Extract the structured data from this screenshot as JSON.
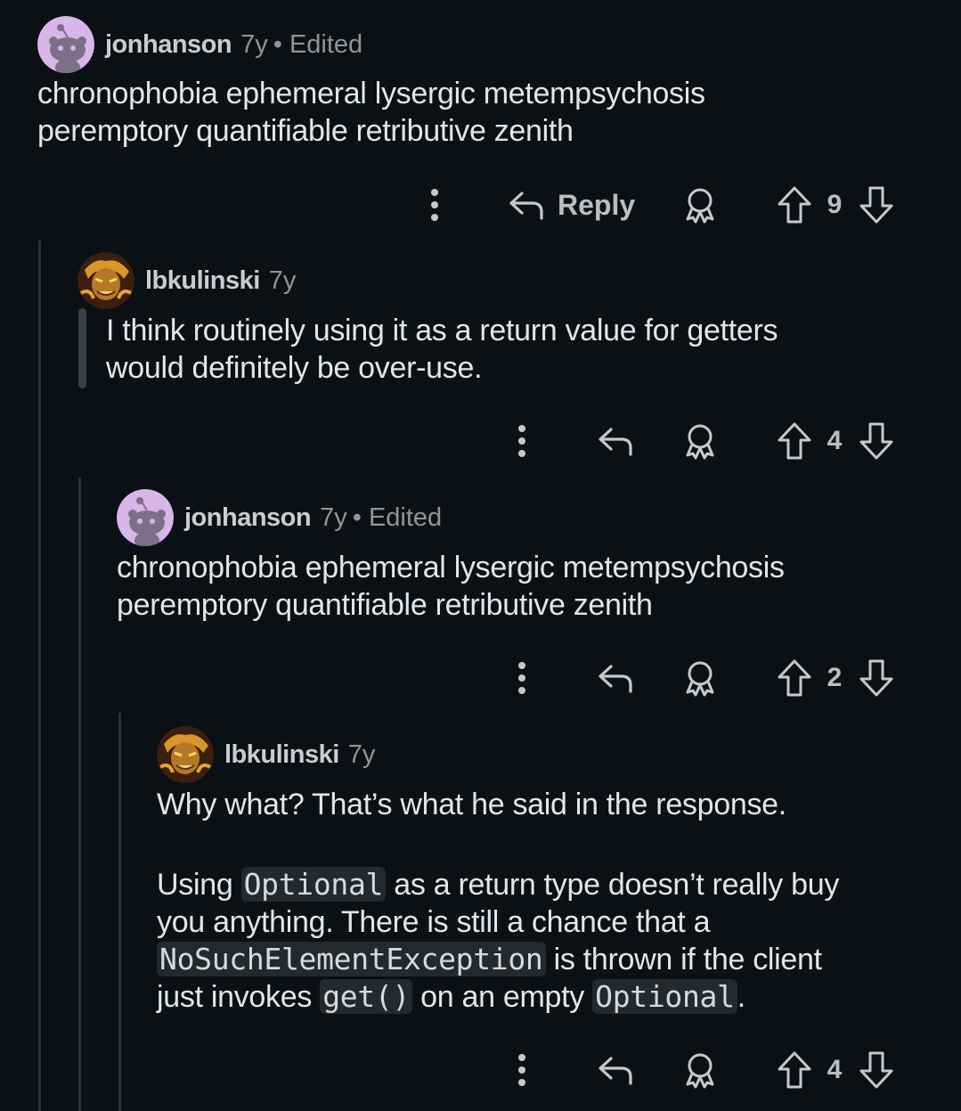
{
  "comments": [
    {
      "username": "jonhanson",
      "age": "7y",
      "edited": "• Edited",
      "text": [
        "chronophobia ephemeral lysergic metempsychosis",
        "peremptory quantifiable retributive zenith"
      ],
      "reply_label": "Reply",
      "votes": "9"
    },
    {
      "username": "lbkulinski",
      "age": "7y",
      "text": [
        "I think routinely using it as a return value for getters",
        "would definitely be over-use."
      ],
      "votes": "4"
    },
    {
      "username": "jonhanson",
      "age": "7y",
      "edited": "• Edited",
      "text": [
        "chronophobia ephemeral lysergic metempsychosis",
        "peremptory quantifiable retributive zenith"
      ],
      "votes": "2"
    },
    {
      "username": "lbkulinski",
      "age": "7y",
      "para1": "Why what? That’s what he said in the response.",
      "para2": {
        "t1": "Using ",
        "c1": "Optional",
        "t2": " as a return type doesn’t really buy",
        "t3": "you anything. There is still a chance that a",
        "c2": "NoSuchElementException",
        "t4": " is thrown if the client",
        "t5": "just invokes ",
        "c3": "get()",
        "t6": " on an empty ",
        "c4": "Optional",
        "t7": "."
      },
      "votes": "4"
    }
  ],
  "icons": {
    "more": "more-vertical-icon",
    "reply": "reply-arrow-icon",
    "award": "award-icon",
    "upvote": "upvote-arrow-icon",
    "downvote": "downvote-arrow-icon"
  },
  "colors": {
    "background": "#0b1014",
    "snoo_avatar": "#d8b6ea",
    "text": "#e3e6e8",
    "muted": "#8d969b"
  }
}
